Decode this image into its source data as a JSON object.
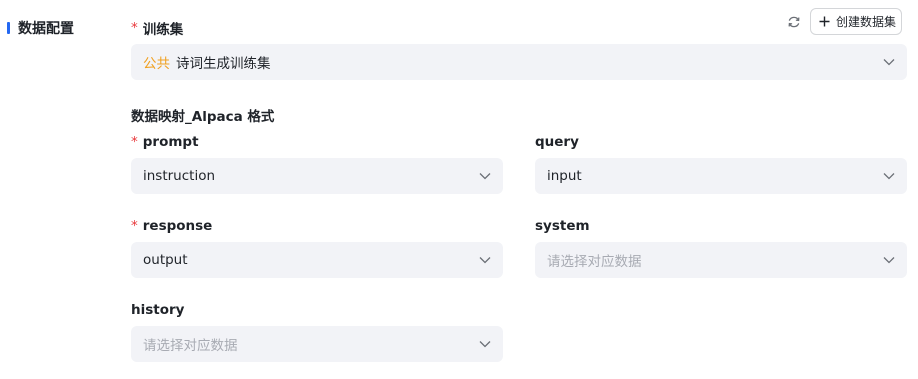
{
  "section": {
    "title": "数据配置"
  },
  "dataset": {
    "label": "训练集",
    "required": "*",
    "tag": "公共",
    "value": "诗词生成训练集"
  },
  "toolbar": {
    "refresh_icon": "refresh-icon",
    "create_label": "创建数据集"
  },
  "mapping": {
    "heading": "数据映射_Alpaca 格式",
    "fields": {
      "prompt": {
        "label": "prompt",
        "required": "*",
        "value": "instruction"
      },
      "query": {
        "label": "query",
        "value": "input"
      },
      "response": {
        "label": "response",
        "required": "*",
        "value": "output"
      },
      "system": {
        "label": "system",
        "placeholder": "请选择对应数据"
      },
      "history": {
        "label": "history",
        "placeholder": "请选择对应数据"
      }
    }
  },
  "colors": {
    "accent": "#2468f2",
    "required": "#e8383b",
    "public_tag": "#f0a020",
    "select_bg": "#f2f3f7",
    "placeholder": "#a8abb3"
  }
}
